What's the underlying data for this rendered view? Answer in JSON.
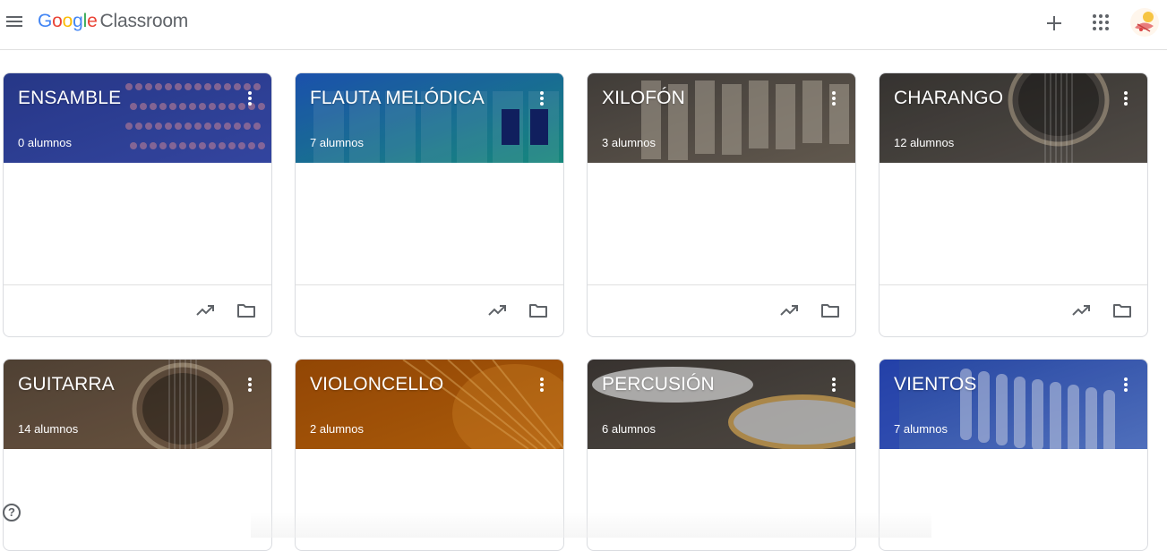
{
  "app": {
    "brand_google": [
      "G",
      "o",
      "o",
      "g",
      "l",
      "e"
    ],
    "brand_product": "Classroom",
    "brand_colors": [
      "#4285F4",
      "#EA4335",
      "#FBBC05",
      "#4285F4",
      "#34A853",
      "#EA4335"
    ]
  },
  "topbar": {
    "menu_icon": "hamburger-menu-icon",
    "create_icon": "plus-icon",
    "apps_icon": "google-apps-grid-icon",
    "avatar_icon": "account-avatar"
  },
  "courses": [
    {
      "title": "ENSAMBLE",
      "students": "0 alumnos",
      "theme": "ensemble-photo",
      "colors": [
        "#2c3f9a",
        "#3b4fb5"
      ]
    },
    {
      "title": "FLAUTA MELÓDICA",
      "students": "7 alumnos",
      "theme": "melodica-keys",
      "colors": [
        "#1f5cc4",
        "#1a9b8d"
      ]
    },
    {
      "title": "XILOFÓN",
      "students": "3 alumnos",
      "theme": "xylophone-bars",
      "colors": [
        "#4a4541",
        "#6f6559"
      ]
    },
    {
      "title": "CHARANGO",
      "students": "12 alumnos",
      "theme": "charango-photo",
      "colors": [
        "#3d3a37",
        "#5c5650"
      ]
    },
    {
      "title": "GUITARRA",
      "students": "14 alumnos",
      "theme": "guitar-photo",
      "colors": [
        "#5a4a3b",
        "#7a6049"
      ]
    },
    {
      "title": "VIOLONCELLO",
      "students": "2 alumnos",
      "theme": "cello-photo",
      "colors": [
        "#a65005",
        "#c4690d"
      ]
    },
    {
      "title": "PERCUSIÓN",
      "students": "6 alumnos",
      "theme": "drums-photo",
      "colors": [
        "#3f3a36",
        "#5a534c"
      ]
    },
    {
      "title": "VIENTOS",
      "students": "7 alumnos",
      "theme": "panflute-photo",
      "colors": [
        "#2b4fb8",
        "#5b7fd6"
      ]
    }
  ],
  "card_actions": {
    "trend_icon": "trending-up-icon",
    "folder_icon": "folder-icon"
  },
  "help_icon": "help-circle-icon",
  "help_glyph": "?"
}
